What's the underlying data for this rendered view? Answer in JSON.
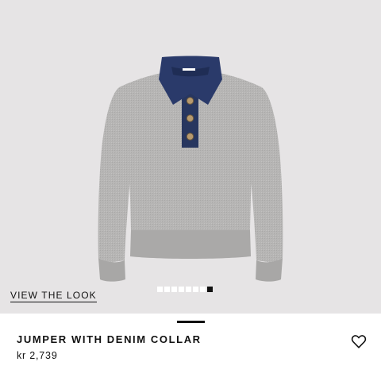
{
  "product": {
    "title": "JUMPER WITH DENIM COLLAR",
    "price": "kr 2,739"
  },
  "gallery": {
    "view_look_label": "VIEW THE LOOK",
    "image_count": 8,
    "active_index": 7
  },
  "icons": {
    "wishlist": "heart-outline-icon"
  },
  "colors": {
    "background": "#e6e4e5",
    "sweater": "#b4b3b2",
    "collar": "#2a3a6a",
    "text": "#111111"
  }
}
